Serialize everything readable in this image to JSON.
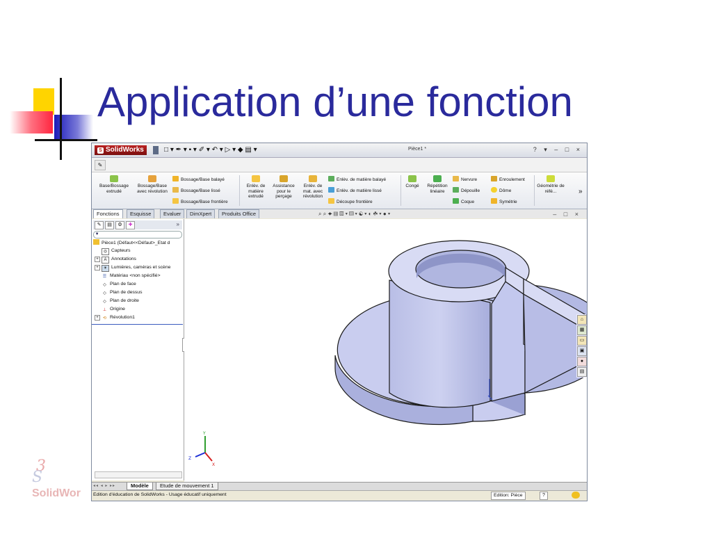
{
  "slide": {
    "title": "Application d’une fonction",
    "watermark": "SolidWor"
  },
  "app": {
    "brand": "SolidWorks",
    "document_title": "Pièce1 *",
    "window_controls": "? ▾ – □ ×",
    "quick_access": "□ ▾ ✒ ▾ ▪ ▾ ✐ ▾ ↶ ▾ ▷ ▾ ◆ ▤ ▾"
  },
  "ribbon": {
    "base_extrude": "Base/Bossage extrudé",
    "base_revolve": "Bossage/Base avec révolution",
    "sweep": "Bossage/Base balayé",
    "loft": "Bossage/Base lissé",
    "boundary": "Bossage/Base frontière",
    "cut_extrude": "Enlèv. de matière extrudé",
    "hole_wizard": "Assistance pour le perçage",
    "cut_revolve": "Enlèv. de mat. avec révolution",
    "cut_sweep": "Enlèv. de matière balayé",
    "cut_loft": "Enlèv. de matière lissé",
    "boundary_cut": "Découpe frontière",
    "fillet": "Congé",
    "linear_pattern": "Répétition linéaire",
    "rib": "Nervure",
    "draft": "Dépouille",
    "shell": "Coque",
    "wrap": "Enroulement",
    "dome": "Dôme",
    "mirror": "Symétrie",
    "ref_geometry": "Géométrie de réfé...",
    "more": "»"
  },
  "tabs": [
    "Fonctions",
    "Esquisse",
    "Evaluer",
    "DimXpert",
    "Produits Office"
  ],
  "viewport_tools": "⌕ ⌕ ✦ ▥ ▧ ▾ ▨ ▾ ☯ ▾ ◐ ☘ ▾ ● ▾",
  "doc_controls": "– □ ×",
  "tree": {
    "collapse": "»",
    "root": "Pièce1  (Défaut<<Défaut>_Etat d",
    "items": [
      "Capteurs",
      "Annotations",
      "Lumières, caméras et scène",
      "Matériau <non spécifié>",
      "Plan de face",
      "Plan de dessus",
      "Plan de droite",
      "Origine",
      "Révolution1"
    ]
  },
  "bottom_tabs": [
    "Modèle",
    "Etude de mouvement 1"
  ],
  "status": {
    "text": "Edition d'éducation de SolidWorks - Usage éducatif uniquement",
    "edit": "Edition: Pièce",
    "help": "?"
  },
  "colors": {
    "title": "#2a2a9c",
    "part_fill": "#c9cdef",
    "part_edge": "#1a1a1a",
    "brand_red": "#b8231c"
  }
}
